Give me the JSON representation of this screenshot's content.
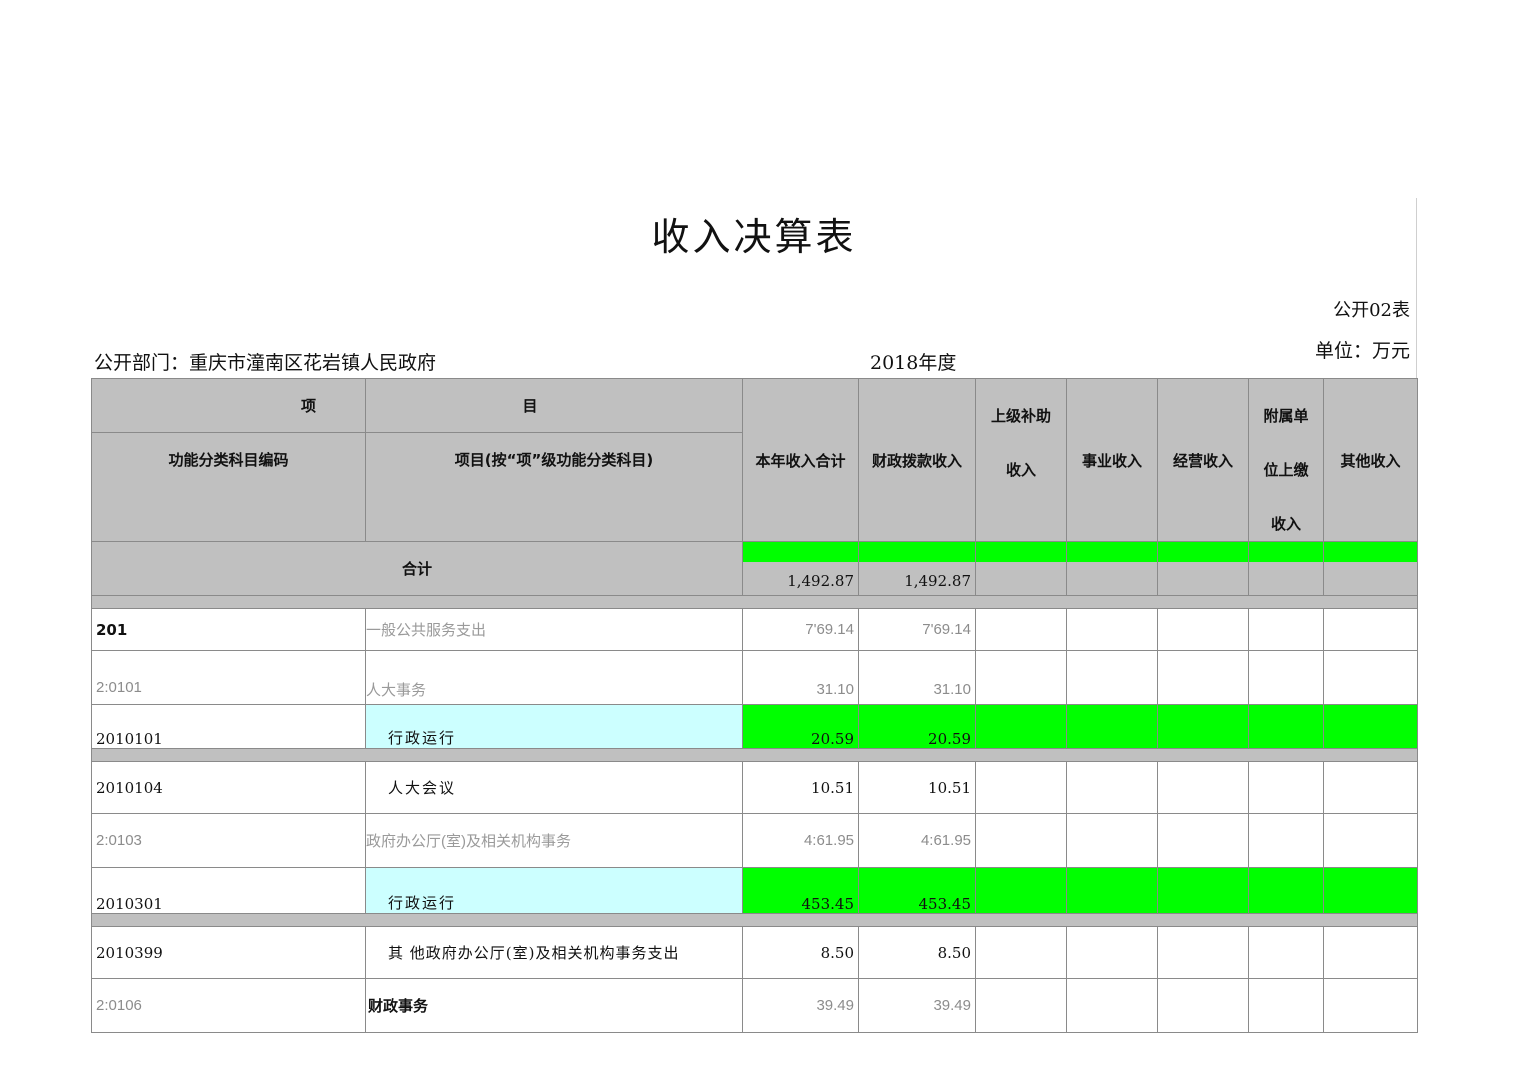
{
  "title": "收入决算表",
  "form_no": "公开02表",
  "unit": "单位：万元",
  "department": "公开部门：重庆市潼南区花岩镇人民政府",
  "year": "2018年度",
  "header": {
    "item": "项",
    "item2": "目",
    "code": "功能分类科目编码",
    "name": "项目(按“项”级功能分类科目)",
    "total": "本年收入合计",
    "fiscal": "财政拨款收入",
    "upper_1": "上级补助",
    "upper_2": "收入",
    "business": "事业收入",
    "operating": "经营收入",
    "affil_1": "附属单",
    "affil_2": "位上缴",
    "affil_3": "收入",
    "other": "其他收入"
  },
  "total_row": {
    "label": "合计",
    "total": "1,492.87",
    "fiscal": "1,492.87"
  },
  "rows": [
    {
      "code": "201",
      "name": "一般公共服务支出",
      "total": "7'69.14",
      "fiscal": "7'69.14"
    },
    {
      "code": "2:0101",
      "name": "人大事务",
      "total": "31.10",
      "fiscal": "31.10"
    },
    {
      "code": "2010101",
      "name": "行政运行",
      "total": "20.59",
      "fiscal": "20.59"
    },
    {
      "code": "2010104",
      "name": "人大会议",
      "total": "10.51",
      "fiscal": "10.51"
    },
    {
      "code": "2:0103",
      "name": "政府办公厅(室)及相关机构事务",
      "total": "4:61.95",
      "fiscal": "4:61.95"
    },
    {
      "code": "2010301",
      "name": "行政运行",
      "total": "453.45",
      "fiscal": "453.45"
    },
    {
      "code": "2010399",
      "name": "其 他政府办公厅(室)及相关机构事务支出",
      "total": "8.50",
      "fiscal": "8.50"
    },
    {
      "code": "2:0106",
      "name": "财政事务",
      "total": "39.49",
      "fiscal": "39.49"
    }
  ]
}
